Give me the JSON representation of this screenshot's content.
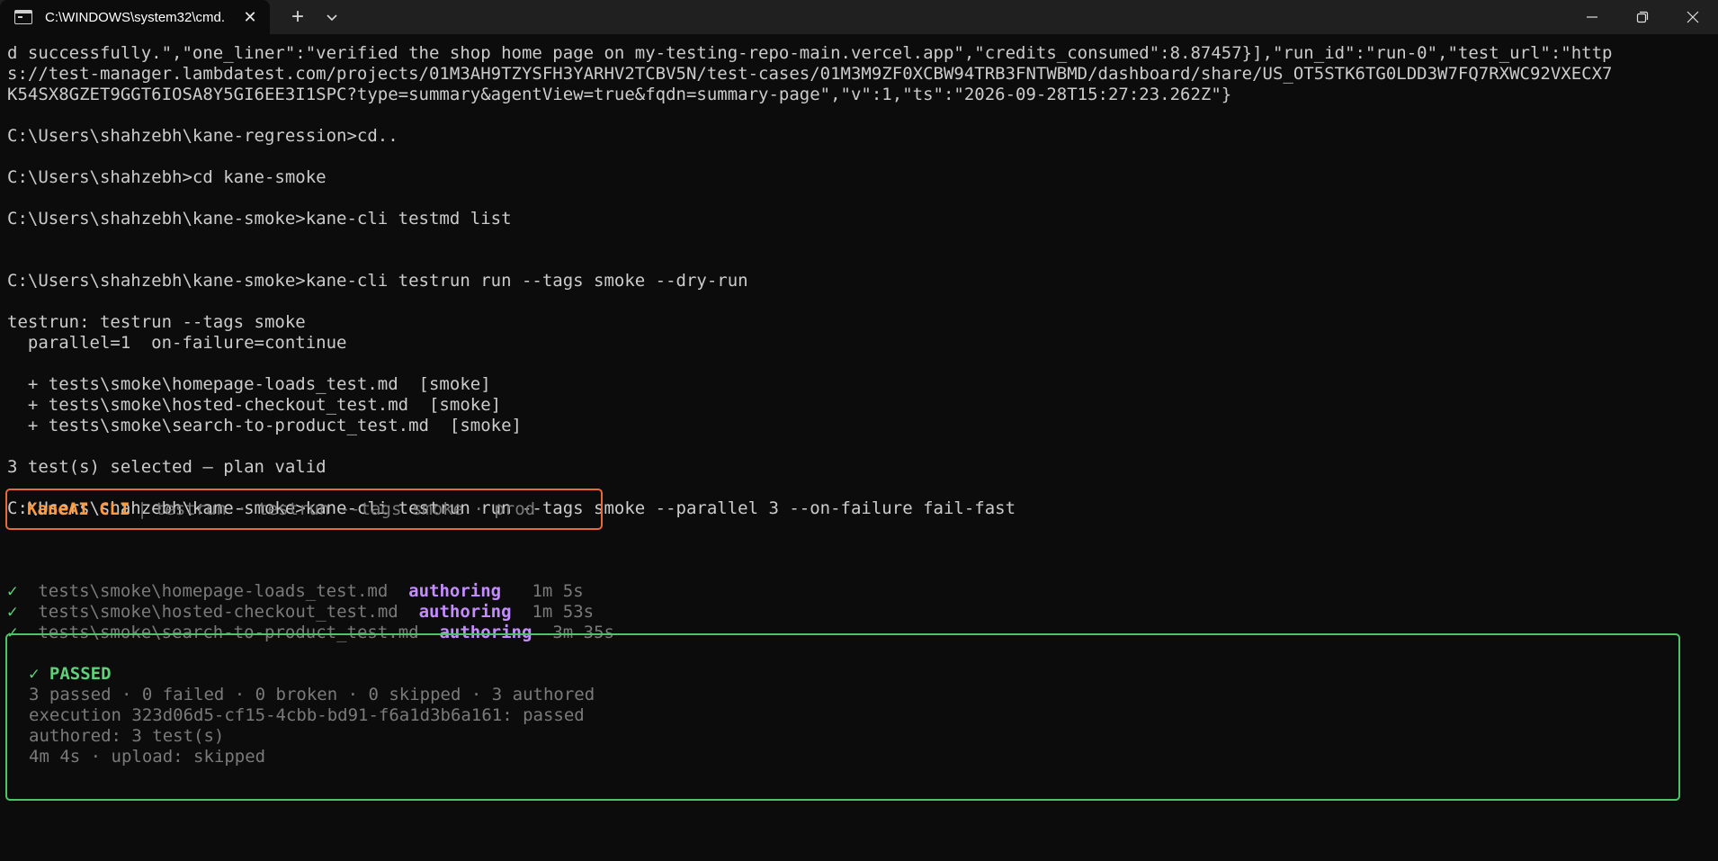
{
  "titlebar": {
    "tab_title": "C:\\WINDOWS\\system32\\cmd.",
    "tab_icon": "terminal-icon",
    "close_glyph": "✕",
    "new_tab_glyph": "+",
    "dropdown_glyph": "⌄"
  },
  "terminal": {
    "lines": [
      "d successfully.\",\"one_liner\":\"verified the shop home page on my-testing-repo-main.vercel.app\",\"credits_consumed\":8.87457}],\"run_id\":\"run-0\",\"test_url\":\"http",
      "s://test-manager.lambdatest.com/projects/01M3AH9TZYSFH3YARHV2TCBV5N/test-cases/01M3M9ZF0XCBW94TRB3FNTWBMD/dashboard/share/US_OT5STK6TG0LDD3W7FQ7RXWC92VXECX7",
      "K54SX8GZET9GGT6IOSA8Y5GI6EE3I1SPC?type=summary&agentView=true&fqdn=summary-page\",\"v\":1,\"ts\":\"2026-09-28T15:27:23.262Z\"}",
      "",
      "C:\\Users\\shahzebh\\kane-regression>cd..",
      "",
      "C:\\Users\\shahzebh>cd kane-smoke",
      "",
      "C:\\Users\\shahzebh\\kane-smoke>kane-cli testmd list",
      "",
      "",
      "C:\\Users\\shahzebh\\kane-smoke>kane-cli testrun run --tags smoke --dry-run",
      "",
      "testrun: testrun --tags smoke",
      "  parallel=1  on-failure=continue",
      "",
      "  + tests\\smoke\\homepage-loads_test.md  [smoke]",
      "  + tests\\smoke\\hosted-checkout_test.md  [smoke]",
      "  + tests\\smoke\\search-to-product_test.md  [smoke]",
      "",
      "3 test(s) selected — plan valid",
      "",
      "C:\\Users\\shahzebh\\kane-smoke>kane-cli testrun run --tags smoke --parallel 3 --on-failure fail-fast"
    ]
  },
  "banner": {
    "brand": "KaneAI CLI",
    "divider": "|",
    "info": "testrun · testrun --tags smoke · prod"
  },
  "results": [
    {
      "check": "✓",
      "file": "tests\\smoke\\homepage-loads_test.md",
      "status": "authoring",
      "duration": "1m 5s"
    },
    {
      "check": "✓",
      "file": "tests\\smoke\\hosted-checkout_test.md",
      "status": "authoring",
      "duration": "1m 53s"
    },
    {
      "check": "✓",
      "file": "tests\\smoke\\search-to-product_test.md",
      "status": "authoring",
      "duration": "3m 35s"
    }
  ],
  "summary": {
    "status": "✓ PASSED",
    "counts": "3 passed · 0 failed · 0 broken · 0 skipped · 3 authored",
    "execution": "execution 323d06d5-cf15-4cbb-bd91-f6a1d3b6a161: passed",
    "authored": "authored: 3 test(s)",
    "timing": "4m 4s · upload: skipped"
  },
  "colors": {
    "background": "#0c0c0c",
    "banner_border": "#e86a3a",
    "brand": "#ff9a3c",
    "success": "#5ed17a",
    "status_purple": "#c48cff"
  }
}
